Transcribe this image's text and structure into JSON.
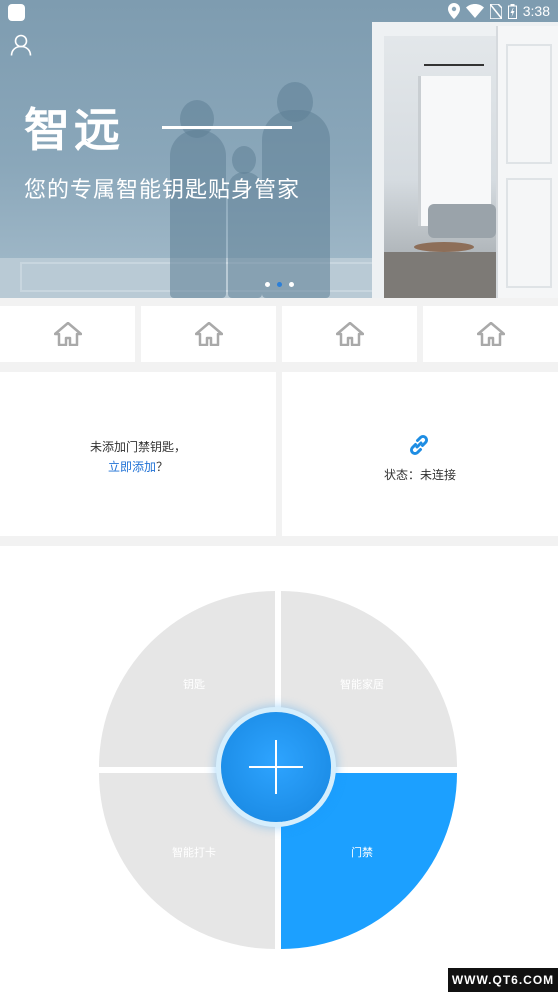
{
  "status_bar": {
    "time": "3:38"
  },
  "banner": {
    "brand": "智远",
    "slogan": "您的专属智能钥匙贴身管家",
    "slide_count": 3,
    "active_slide": 2
  },
  "tiles": [
    {
      "icon": "home-icon"
    },
    {
      "icon": "home-icon"
    },
    {
      "icon": "home-icon"
    },
    {
      "icon": "home-icon"
    }
  ],
  "key_card": {
    "text": "未添加门禁钥匙，",
    "link": "立即添加",
    "suffix": "？"
  },
  "status_card": {
    "icon": "link-icon",
    "text": "状态：未连接"
  },
  "wheel": {
    "quadrants": [
      {
        "label": "钥匙"
      },
      {
        "label": "智能家居"
      },
      {
        "label": "智能打卡"
      },
      {
        "label": "门禁"
      }
    ],
    "active_quadrant": "门禁",
    "colors": {
      "inactive": "#e6e6e6",
      "active": "#1ca0ff"
    }
  },
  "watermark": "WWW.QT6.COM"
}
